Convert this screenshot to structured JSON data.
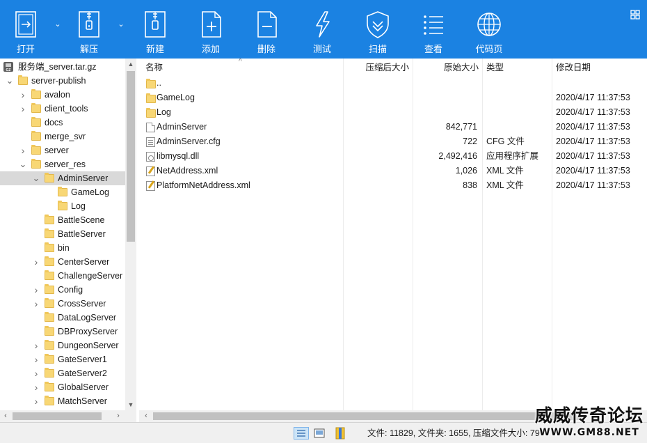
{
  "toolbar": {
    "buttons": [
      {
        "label": "打开",
        "icon": "open-icon",
        "has_dropdown": true
      },
      {
        "label": "解压",
        "icon": "extract-icon",
        "has_dropdown": true
      },
      {
        "label": "新建",
        "icon": "new-archive-icon"
      },
      {
        "label": "添加",
        "icon": "add-icon"
      },
      {
        "label": "删除",
        "icon": "delete-icon"
      },
      {
        "label": "测试",
        "icon": "test-icon"
      },
      {
        "label": "扫描",
        "icon": "scan-shield-icon"
      },
      {
        "label": "查看",
        "icon": "view-list-icon"
      },
      {
        "label": "代码页",
        "icon": "globe-icon"
      }
    ],
    "accent_color": "#1b82e2"
  },
  "tree": {
    "root": "服务端_server.tar.gz",
    "items": [
      {
        "label": "server-publish",
        "depth": 1,
        "expanded": true
      },
      {
        "label": "avalon",
        "depth": 2,
        "expandable": true
      },
      {
        "label": "client_tools",
        "depth": 2,
        "expandable": true
      },
      {
        "label": "docs",
        "depth": 2
      },
      {
        "label": "merge_svr",
        "depth": 2
      },
      {
        "label": "server",
        "depth": 2,
        "expandable": true
      },
      {
        "label": "server_res",
        "depth": 2,
        "expanded": true
      },
      {
        "label": "AdminServer",
        "depth": 3,
        "expanded": true,
        "selected": true
      },
      {
        "label": "GameLog",
        "depth": 4
      },
      {
        "label": "Log",
        "depth": 4
      },
      {
        "label": "BattleScene",
        "depth": 3
      },
      {
        "label": "BattleServer",
        "depth": 3
      },
      {
        "label": "bin",
        "depth": 3
      },
      {
        "label": "CenterServer",
        "depth": 3,
        "expandable": true
      },
      {
        "label": "ChallengeServer",
        "depth": 3
      },
      {
        "label": "Config",
        "depth": 3,
        "expandable": true
      },
      {
        "label": "CrossServer",
        "depth": 3,
        "expandable": true
      },
      {
        "label": "DataLogServer",
        "depth": 3
      },
      {
        "label": "DBProxyServer",
        "depth": 3
      },
      {
        "label": "DungeonServer",
        "depth": 3,
        "expandable": true
      },
      {
        "label": "GateServer1",
        "depth": 3,
        "expandable": true
      },
      {
        "label": "GateServer2",
        "depth": 3,
        "expandable": true
      },
      {
        "label": "GlobalServer",
        "depth": 3,
        "expandable": true
      },
      {
        "label": "MatchServer",
        "depth": 3,
        "expandable": true
      }
    ]
  },
  "list": {
    "columns": {
      "name": "名称",
      "compressed": "压缩后大小",
      "original": "原始大小",
      "type": "类型",
      "modified": "修改日期"
    },
    "rows": [
      {
        "icon": "folder",
        "name": "..",
        "compressed": "",
        "original": "",
        "type": "",
        "modified": ""
      },
      {
        "icon": "folder",
        "name": "GameLog",
        "compressed": "",
        "original": "",
        "type": "",
        "modified": "2020/4/17 11:37:53"
      },
      {
        "icon": "folder",
        "name": "Log",
        "compressed": "",
        "original": "",
        "type": "",
        "modified": "2020/4/17 11:37:53"
      },
      {
        "icon": "file",
        "name": "AdminServer",
        "compressed": "",
        "original": "842,771",
        "type": "",
        "modified": "2020/4/17 11:37:53"
      },
      {
        "icon": "cfg",
        "name": "AdminServer.cfg",
        "compressed": "",
        "original": "722",
        "type": "CFG 文件",
        "modified": "2020/4/17 11:37:53"
      },
      {
        "icon": "dll",
        "name": "libmysql.dll",
        "compressed": "",
        "original": "2,492,416",
        "type": "应用程序扩展",
        "modified": "2020/4/17 11:37:53"
      },
      {
        "icon": "xml",
        "name": "NetAddress.xml",
        "compressed": "",
        "original": "1,026",
        "type": "XML 文件",
        "modified": "2020/4/17 11:37:53"
      },
      {
        "icon": "xml",
        "name": "PlatformNetAddress.xml",
        "compressed": "",
        "original": "838",
        "type": "XML 文件",
        "modified": "2020/4/17 11:37:53"
      }
    ]
  },
  "status": {
    "text": "文件: 11829, 文件夹: 1655, 压缩文件大小: 79"
  },
  "watermark": {
    "line1": "威威传奇论坛",
    "line2": "WWW.GM88.NET"
  }
}
